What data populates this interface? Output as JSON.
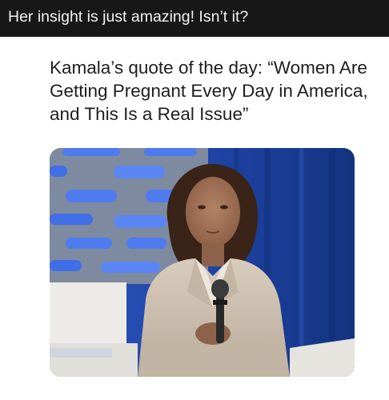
{
  "post": {
    "caption": "Her insight is just amazing! Isn’t it?"
  },
  "meme": {
    "headline": "Kamala’s quote of the day: “Women Are Getting Pregnant Every Day in America, and This Is a Real Issue”"
  },
  "photo": {
    "subject": "woman in beige suit seated holding microphone",
    "colors": {
      "backdrop_blue": "#1f45a8",
      "panel_gray": "#7d8aa0",
      "suit_beige": "#cfc3b4",
      "chair_white": "#ecebe7"
    }
  }
}
